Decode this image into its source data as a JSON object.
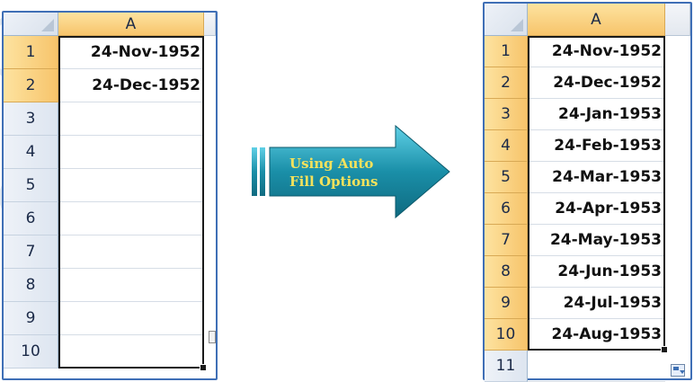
{
  "left_sheet": {
    "column_header": "A",
    "rows": [
      {
        "num": "1",
        "value": "24-Nov-1952"
      },
      {
        "num": "2",
        "value": "24-Dec-1952"
      },
      {
        "num": "3",
        "value": ""
      },
      {
        "num": "4",
        "value": ""
      },
      {
        "num": "5",
        "value": ""
      },
      {
        "num": "6",
        "value": ""
      },
      {
        "num": "7",
        "value": ""
      },
      {
        "num": "8",
        "value": ""
      },
      {
        "num": "9",
        "value": ""
      },
      {
        "num": "10",
        "value": ""
      }
    ]
  },
  "arrow": {
    "line1": "Using Auto",
    "line2": "Fill Options"
  },
  "right_sheet": {
    "column_header": "A",
    "rows": [
      {
        "num": "1",
        "value": "24-Nov-1952"
      },
      {
        "num": "2",
        "value": "24-Dec-1952"
      },
      {
        "num": "3",
        "value": "24-Jan-1953"
      },
      {
        "num": "4",
        "value": "24-Feb-1953"
      },
      {
        "num": "5",
        "value": "24-Mar-1953"
      },
      {
        "num": "6",
        "value": "24-Apr-1953"
      },
      {
        "num": "7",
        "value": "24-May-1953"
      },
      {
        "num": "8",
        "value": "24-Jun-1953"
      },
      {
        "num": "9",
        "value": "24-Jul-1953"
      },
      {
        "num": "10",
        "value": "24-Aug-1953"
      },
      {
        "num": "11",
        "value": ""
      }
    ]
  },
  "colors": {
    "selected_header": "#f7c46b",
    "sheet_border": "#3f6fb6",
    "arrow_fill": "#1a8fa8",
    "arrow_text": "#f4e25c"
  }
}
